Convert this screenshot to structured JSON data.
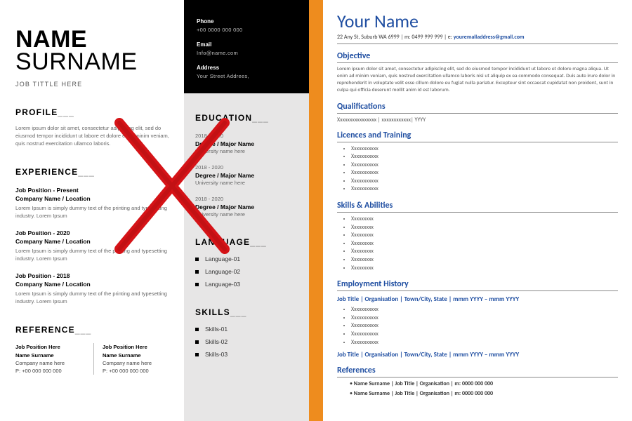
{
  "left": {
    "name_first": "NAME",
    "name_last": "SURNAME",
    "job_title": "JOB TITTLE HERE",
    "contact": {
      "phone_label": "Phone",
      "phone_value": "+00 0000 000 000",
      "email_label": "Email",
      "email_value": "Info@name.com",
      "address_label": "Address",
      "address_value": "Your Street Addrees,"
    },
    "profile": {
      "heading": "PROFILE",
      "text": "Lorem ipsum dolor sit amet, consectetur adipiscing elit, sed do eiusmod tempor incididunt ut labore et dolore enim  minim veniam, quis nostrud exercitation ullamco laboris."
    },
    "experience": {
      "heading": "EXPERIENCE",
      "items": [
        {
          "line1": "Job Position - Present",
          "line2": "Company Name / Location",
          "desc": "Lorem Ipsum is simply dummy text of the printing and typesetting industry. Lorem Ipsum"
        },
        {
          "line1": "Job Position - 2020",
          "line2": "Company Name / Location",
          "desc": "Lorem Ipsum is simply dummy text of the printing and typesetting industry. Lorem Ipsum"
        },
        {
          "line1": "Job Position - 2018",
          "line2": "Company Name / Location",
          "desc": "Lorem Ipsum is simply dummy text of the printing and typesetting industry. Lorem Ipsum"
        }
      ]
    },
    "reference": {
      "heading": "REFERENCE",
      "cols": [
        {
          "position": "Job Position Here",
          "name": "Name Surname",
          "company": "Company name here",
          "phone": "P: +00 000 000 000"
        },
        {
          "position": "Job Position Here",
          "name": "Name Surname",
          "company": "Company name here",
          "phone": "P: +00 000 000 000"
        }
      ]
    },
    "education": {
      "heading": "EDUCATION",
      "items": [
        {
          "years": "2018 - 2020",
          "degree": "Degree / Major Name",
          "university": "University name here"
        },
        {
          "years": "2018 - 2020",
          "degree": "Degree / Major Name",
          "university": "University name here"
        },
        {
          "years": "2018 - 2020",
          "degree": "Degree / Major Name",
          "university": "University name here"
        }
      ]
    },
    "language": {
      "heading": "LANGUAGE",
      "items": [
        "Language-01",
        "Language-02",
        "Language-03"
      ]
    },
    "skills": {
      "heading": "SKILLS",
      "items": [
        "Skills-01",
        "Skills-02",
        "Skills-03"
      ]
    }
  },
  "right": {
    "name": "Your Name",
    "address_line": "22 Any St, Suburb WA 6999 | m: 0499 999 999 | e: ",
    "email": "youremailaddress@gmail.com",
    "objective": {
      "heading": "Objective",
      "text": "Lorem ipsum dolor sit amet, consectetur adipiscing elit, sed do eiusmod tempor incididunt ut labore et dolore magna aliqua. Ut enim ad minim veniam, quis nostrud exercitation ullamco laboris nisi ut aliquip ex ea commodo consequat. Duis aute irure dolor in reprehenderit in voluptate velit esse cillum dolore eu fugiat nulla pariatur. Excepteur sint occaecat cupidatat non proident, sunt in culpa qui officia deserunt mollit anim id est laborum."
    },
    "qualifications": {
      "heading": "Qualifications",
      "line": "Xxxxxxxxxxxxxxxx | xxxxxxxxxxxx| YYYY"
    },
    "licences": {
      "heading": "Licences and Training",
      "items": [
        "Xxxxxxxxxxx",
        "Xxxxxxxxxxx",
        "Xxxxxxxxxxx",
        "Xxxxxxxxxxx",
        "Xxxxxxxxxxx",
        "Xxxxxxxxxxx"
      ]
    },
    "skills": {
      "heading": "Skills & Abilities",
      "items": [
        "Xxxxxxxxx",
        "Xxxxxxxxx",
        "Xxxxxxxxx",
        "Xxxxxxxxx",
        "Xxxxxxxxx",
        "Xxxxxxxxx",
        "Xxxxxxxxx"
      ]
    },
    "employment": {
      "heading": "Employment History",
      "jobs": [
        {
          "header": "Job Title | Organisation | Town/City, State | mmm YYYY – mmm YYYY",
          "bullets": [
            "Xxxxxxxxxxx",
            "Xxxxxxxxxxx",
            "Xxxxxxxxxxx",
            "Xxxxxxxxxxx",
            "Xxxxxxxxxxx"
          ]
        },
        {
          "header": "Job Title | Organisation | Town/City, State | mmm YYYY – mmm YYYY"
        }
      ]
    },
    "references": {
      "heading": "References",
      "items": [
        "Name Surname | Job Title | Organisation | m: 0000 000 000",
        "Name Surname | Job Title | Organisation | m: 0000 000 000"
      ]
    }
  },
  "marks": {
    "cross_color": "#d51317",
    "check_color": "#18c400"
  }
}
